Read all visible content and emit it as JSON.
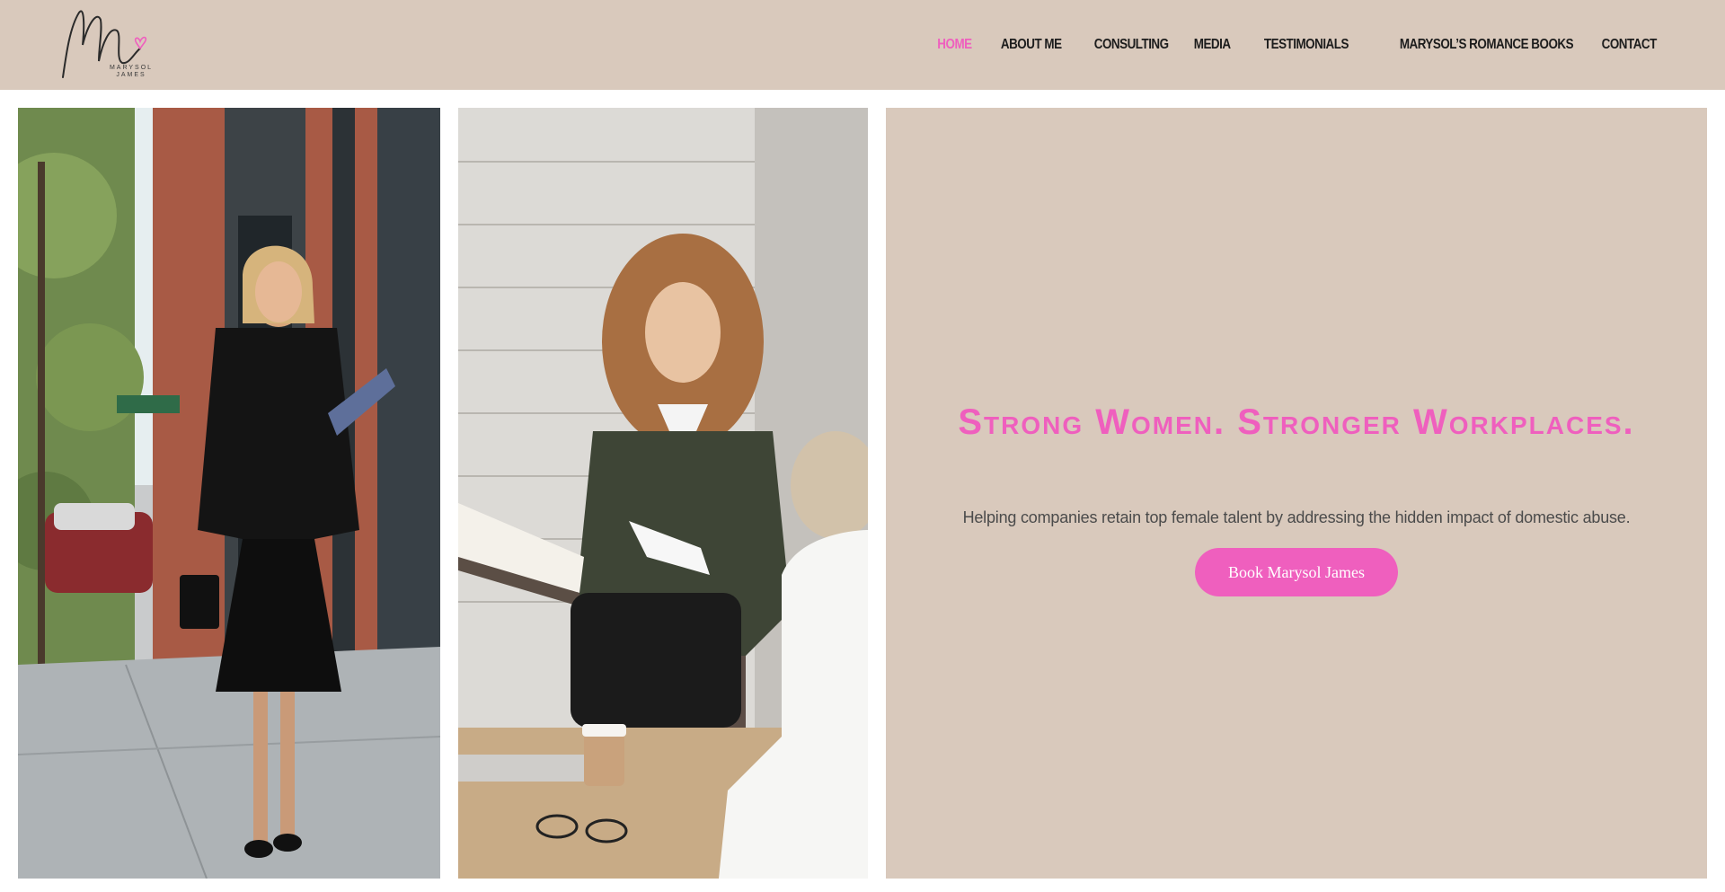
{
  "header": {
    "logo": {
      "monogram": "M",
      "name_line1": "MARYSOL",
      "name_line2": "JAMES"
    },
    "nav": [
      {
        "label": "Home",
        "active": true
      },
      {
        "label": "About Me",
        "active": false
      },
      {
        "label": "Consulting",
        "active": false
      },
      {
        "label": "Media",
        "active": false
      },
      {
        "label": "Testimonials",
        "active": false
      },
      {
        "label": "Marysol’s Romance Books",
        "active": false
      },
      {
        "label": "Contact",
        "active": false
      }
    ]
  },
  "photos": [
    {
      "name": "businesswoman-walking-photo"
    },
    {
      "name": "woman-holding-papers-photo"
    }
  ],
  "hero": {
    "title": "Strong Women. Stronger Workplaces.",
    "subtitle": "Helping companies retain top female talent by addressing the hidden impact of domestic abuse.",
    "cta_label": "Book Marysol James"
  },
  "colors": {
    "accent": "#ef5fbe",
    "header_bg": "#d9c9bc",
    "hero_bg": "#d9c9bc",
    "nav_text": "#1d1d1d",
    "body_text": "#4b4b4b"
  }
}
